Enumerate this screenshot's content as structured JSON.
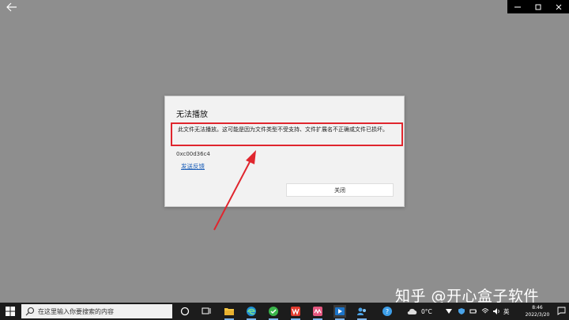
{
  "dialog": {
    "title": "无法播放",
    "message": "此文件无法播放。这可能是因为文件类型不受支持、文件扩展名不正确或文件已损坏。",
    "error_code": "0xc00d36c4",
    "feedback_link": "发送反馈",
    "close_button": "关闭"
  },
  "watermark": "知乎 @开心盒子软件",
  "taskbar": {
    "search_placeholder": "在这里输入你要搜索的内容",
    "weather": "0°C",
    "ime": "英",
    "clock_time": "8:46",
    "clock_date": "2022/3/20"
  },
  "colors": {
    "desktop_bg": "#8e8e8e",
    "highlight_red": "#e0262e",
    "link_blue": "#1c5fb8",
    "taskbar_bg": "#1c1c1c"
  },
  "icons": [
    "back-arrow-icon",
    "minimize-icon",
    "maximize-icon",
    "close-icon",
    "windows-start-icon",
    "search-icon",
    "cortana-icon",
    "task-view-icon",
    "file-explorer-icon",
    "edge-icon",
    "green-app-icon",
    "wps-icon",
    "media-app-icon",
    "movies-app-icon",
    "users-app-icon",
    "help-icon",
    "weather-icon",
    "notification-icon"
  ]
}
